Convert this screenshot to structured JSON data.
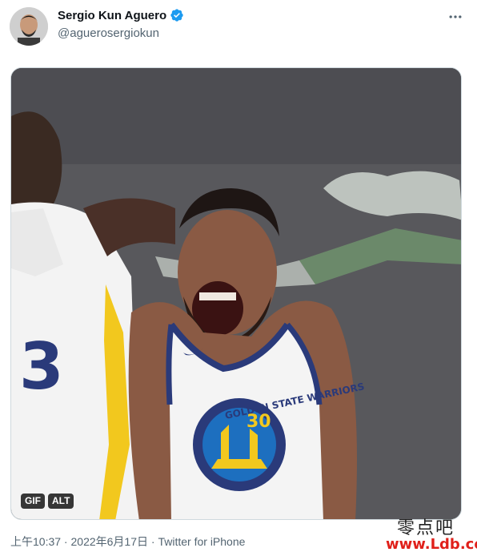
{
  "author": {
    "display_name": "Sergio Kun Aguero",
    "handle": "@aguerosergiokun",
    "verified": true
  },
  "media": {
    "type": "GIF",
    "badges": [
      "GIF",
      "ALT"
    ],
    "jersey_number": "30",
    "jersey_text": "GOLDEN STATE WARRIORS",
    "teammate_number": "3"
  },
  "meta": {
    "time": "上午10:37",
    "separator": " · ",
    "date": "2022年6月17日",
    "source": "Twitter for iPhone"
  },
  "watermark": {
    "line1": "零点吧",
    "line2": "www.Ldb.cc"
  },
  "icons": {
    "more": "more-horizontal-icon",
    "verified": "verified-badge-icon"
  },
  "colors": {
    "verified_blue": "#1d9bf0",
    "text_primary": "#0f1419",
    "text_secondary": "#536471",
    "jersey_navy": "#2a3a7a",
    "jersey_gold": "#f2c81e"
  }
}
